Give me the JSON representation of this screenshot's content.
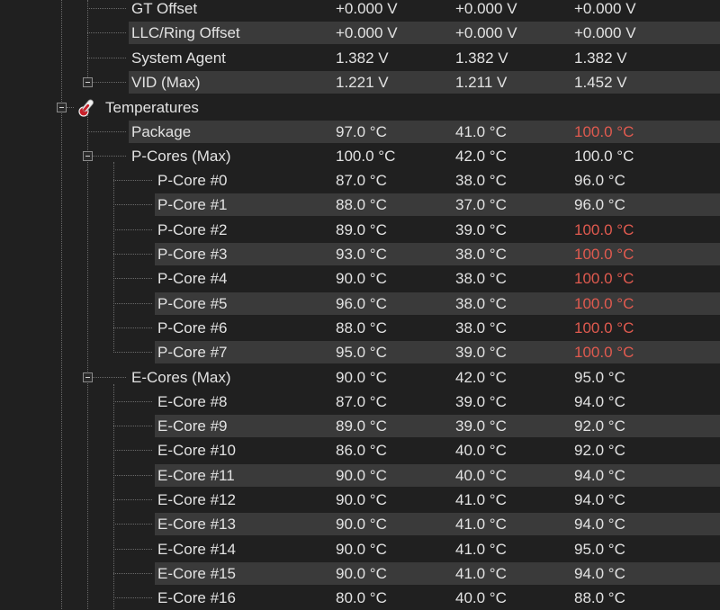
{
  "voltage_rows": [
    {
      "label": "GT Offset",
      "current": "+0.000 V",
      "min": "+0.000 V",
      "max": "+0.000 V"
    },
    {
      "label": "LLC/Ring Offset",
      "current": "+0.000 V",
      "min": "+0.000 V",
      "max": "+0.000 V"
    },
    {
      "label": "System Agent",
      "current": "1.382 V",
      "min": "1.382 V",
      "max": "1.382 V"
    },
    {
      "label": "VID (Max)",
      "current": "1.221 V",
      "min": "1.211 V",
      "max": "1.452 V"
    }
  ],
  "temperatures": {
    "label": "Temperatures",
    "icon": "thermometer-icon",
    "package": {
      "label": "Package",
      "current": "97.0 °C",
      "min": "41.0 °C",
      "max": "100.0 °C",
      "max_hot": true
    },
    "pcores": {
      "label": "P-Cores (Max)",
      "current": "100.0 °C",
      "min": "42.0 °C",
      "max": "100.0 °C",
      "items": [
        {
          "label": "P-Core #0",
          "current": "87.0 °C",
          "min": "38.0 °C",
          "max": "96.0 °C",
          "max_hot": false
        },
        {
          "label": "P-Core #1",
          "current": "88.0 °C",
          "min": "37.0 °C",
          "max": "96.0 °C",
          "max_hot": false
        },
        {
          "label": "P-Core #2",
          "current": "89.0 °C",
          "min": "39.0 °C",
          "max": "100.0 °C",
          "max_hot": true
        },
        {
          "label": "P-Core #3",
          "current": "93.0 °C",
          "min": "38.0 °C",
          "max": "100.0 °C",
          "max_hot": true
        },
        {
          "label": "P-Core #4",
          "current": "90.0 °C",
          "min": "38.0 °C",
          "max": "100.0 °C",
          "max_hot": true
        },
        {
          "label": "P-Core #5",
          "current": "96.0 °C",
          "min": "38.0 °C",
          "max": "100.0 °C",
          "max_hot": true
        },
        {
          "label": "P-Core #6",
          "current": "88.0 °C",
          "min": "38.0 °C",
          "max": "100.0 °C",
          "max_hot": true
        },
        {
          "label": "P-Core #7",
          "current": "95.0 °C",
          "min": "39.0 °C",
          "max": "100.0 °C",
          "max_hot": true
        }
      ]
    },
    "ecores": {
      "label": "E-Cores (Max)",
      "current": "90.0 °C",
      "min": "42.0 °C",
      "max": "95.0 °C",
      "items": [
        {
          "label": "E-Core #8",
          "current": "87.0 °C",
          "min": "39.0 °C",
          "max": "94.0 °C",
          "max_hot": false
        },
        {
          "label": "E-Core #9",
          "current": "89.0 °C",
          "min": "39.0 °C",
          "max": "92.0 °C",
          "max_hot": false
        },
        {
          "label": "E-Core #10",
          "current": "86.0 °C",
          "min": "40.0 °C",
          "max": "92.0 °C",
          "max_hot": false
        },
        {
          "label": "E-Core #11",
          "current": "90.0 °C",
          "min": "40.0 °C",
          "max": "94.0 °C",
          "max_hot": false
        },
        {
          "label": "E-Core #12",
          "current": "90.0 °C",
          "min": "41.0 °C",
          "max": "94.0 °C",
          "max_hot": false
        },
        {
          "label": "E-Core #13",
          "current": "90.0 °C",
          "min": "41.0 °C",
          "max": "94.0 °C",
          "max_hot": false
        },
        {
          "label": "E-Core #14",
          "current": "90.0 °C",
          "min": "41.0 °C",
          "max": "95.0 °C",
          "max_hot": false
        },
        {
          "label": "E-Core #15",
          "current": "90.0 °C",
          "min": "41.0 °C",
          "max": "94.0 °C",
          "max_hot": false
        },
        {
          "label": "E-Core #16",
          "current": "80.0 °C",
          "min": "40.0 °C",
          "max": "88.0 °C",
          "max_hot": false
        }
      ]
    }
  },
  "colors": {
    "background": "#202020",
    "row_band": "#3a3a3a",
    "text": "#e2e2e2",
    "hot_value": "#e05a4f",
    "tree_line": "#6a6a6a"
  }
}
